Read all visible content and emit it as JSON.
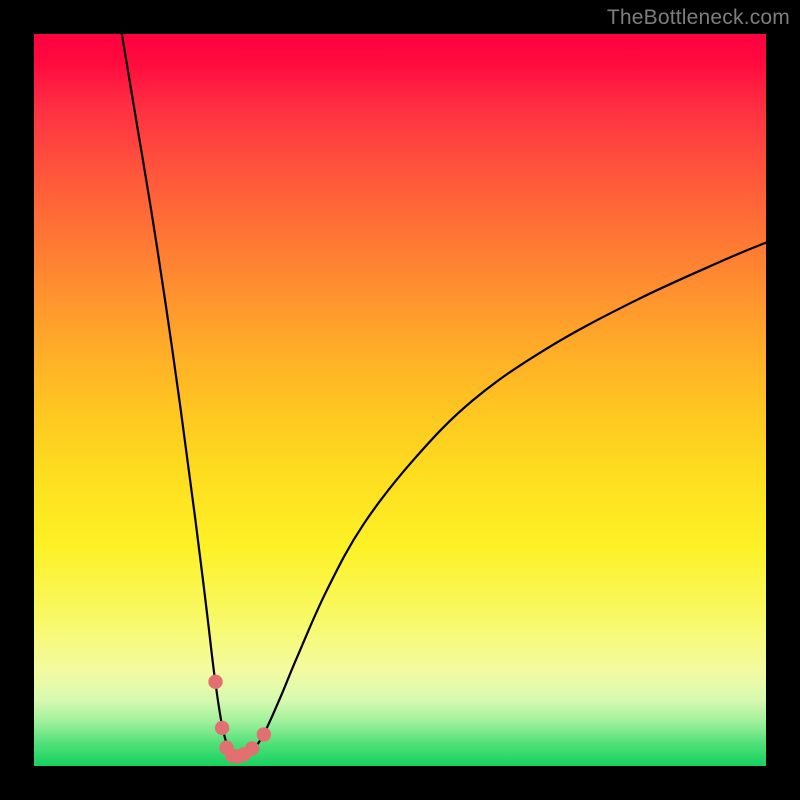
{
  "watermark": "TheBottleneck.com",
  "colors": {
    "background": "#000000",
    "curve_stroke": "#000000",
    "marker_fill": "#e27070",
    "watermark_text": "#7d7d7d"
  },
  "chart_data": {
    "type": "line",
    "title": "",
    "xlabel": "",
    "ylabel": "",
    "xlim": [
      0,
      100
    ],
    "ylim": [
      0,
      100
    ],
    "grid": false,
    "legend": false,
    "background_gradient": {
      "orientation": "vertical",
      "stops": [
        {
          "pos": 0.0,
          "color": "#ff0040"
        },
        {
          "pos": 0.5,
          "color": "#ffc222"
        },
        {
          "pos": 0.8,
          "color": "#f8f968"
        },
        {
          "pos": 1.0,
          "color": "#16d160"
        }
      ]
    },
    "series": [
      {
        "name": "bottleneck-curve",
        "x": [
          12,
          14,
          16,
          18,
          20,
          22,
          23.5,
          24.7,
          25.7,
          26.6,
          27.4,
          28.2,
          29.6,
          31.2,
          33.5,
          36,
          40,
          45,
          52,
          60,
          70,
          82,
          94,
          100
        ],
        "y": [
          100,
          88,
          76,
          63,
          49,
          34,
          22,
          12,
          5.5,
          2.3,
          1.3,
          1.3,
          2.1,
          4.0,
          9,
          15,
          24,
          33,
          42,
          50,
          57,
          63.5,
          69,
          71.5
        ]
      }
    ],
    "markers": [
      {
        "x": 24.8,
        "y": 11.5
      },
      {
        "x": 25.7,
        "y": 5.2
      },
      {
        "x": 26.3,
        "y": 2.5
      },
      {
        "x": 27.1,
        "y": 1.4
      },
      {
        "x": 27.9,
        "y": 1.3
      },
      {
        "x": 28.7,
        "y": 1.6
      },
      {
        "x": 29.8,
        "y": 2.4
      },
      {
        "x": 31.4,
        "y": 4.3
      }
    ]
  }
}
